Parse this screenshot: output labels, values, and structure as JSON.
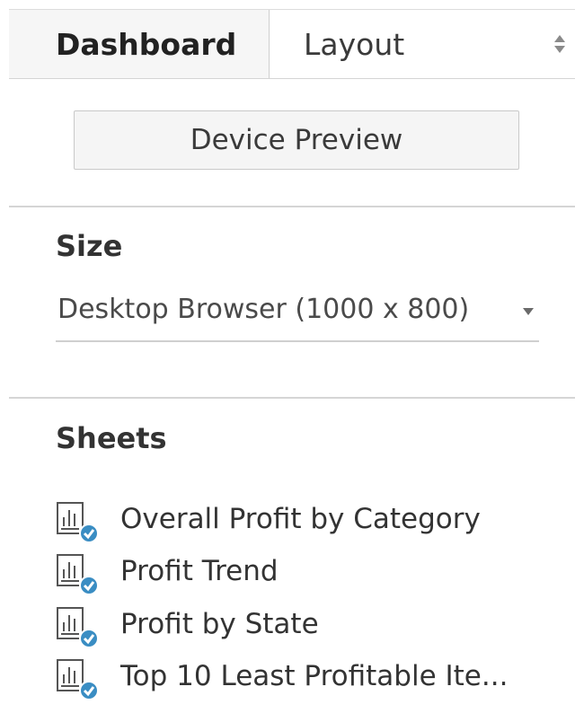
{
  "tabs": {
    "dashboard_label": "Dashboard",
    "layout_label": "Layout"
  },
  "device_preview": {
    "label": "Device Preview"
  },
  "size": {
    "title": "Size",
    "selected": "Desktop Browser (1000 x 800)"
  },
  "sheets": {
    "title": "Sheets",
    "items": [
      {
        "label": "Overall Profit by Category",
        "icon": "worksheet-used-icon"
      },
      {
        "label": "Profit Trend",
        "icon": "worksheet-used-icon"
      },
      {
        "label": "Profit by State",
        "icon": "worksheet-used-icon"
      },
      {
        "label": "Top 10 Least Profitable Ite...",
        "icon": "worksheet-used-icon"
      }
    ]
  },
  "colors": {
    "check_badge": "#3a8dc3",
    "tab_bar": "#f6f6f6",
    "divider": "#d5d5d5"
  }
}
